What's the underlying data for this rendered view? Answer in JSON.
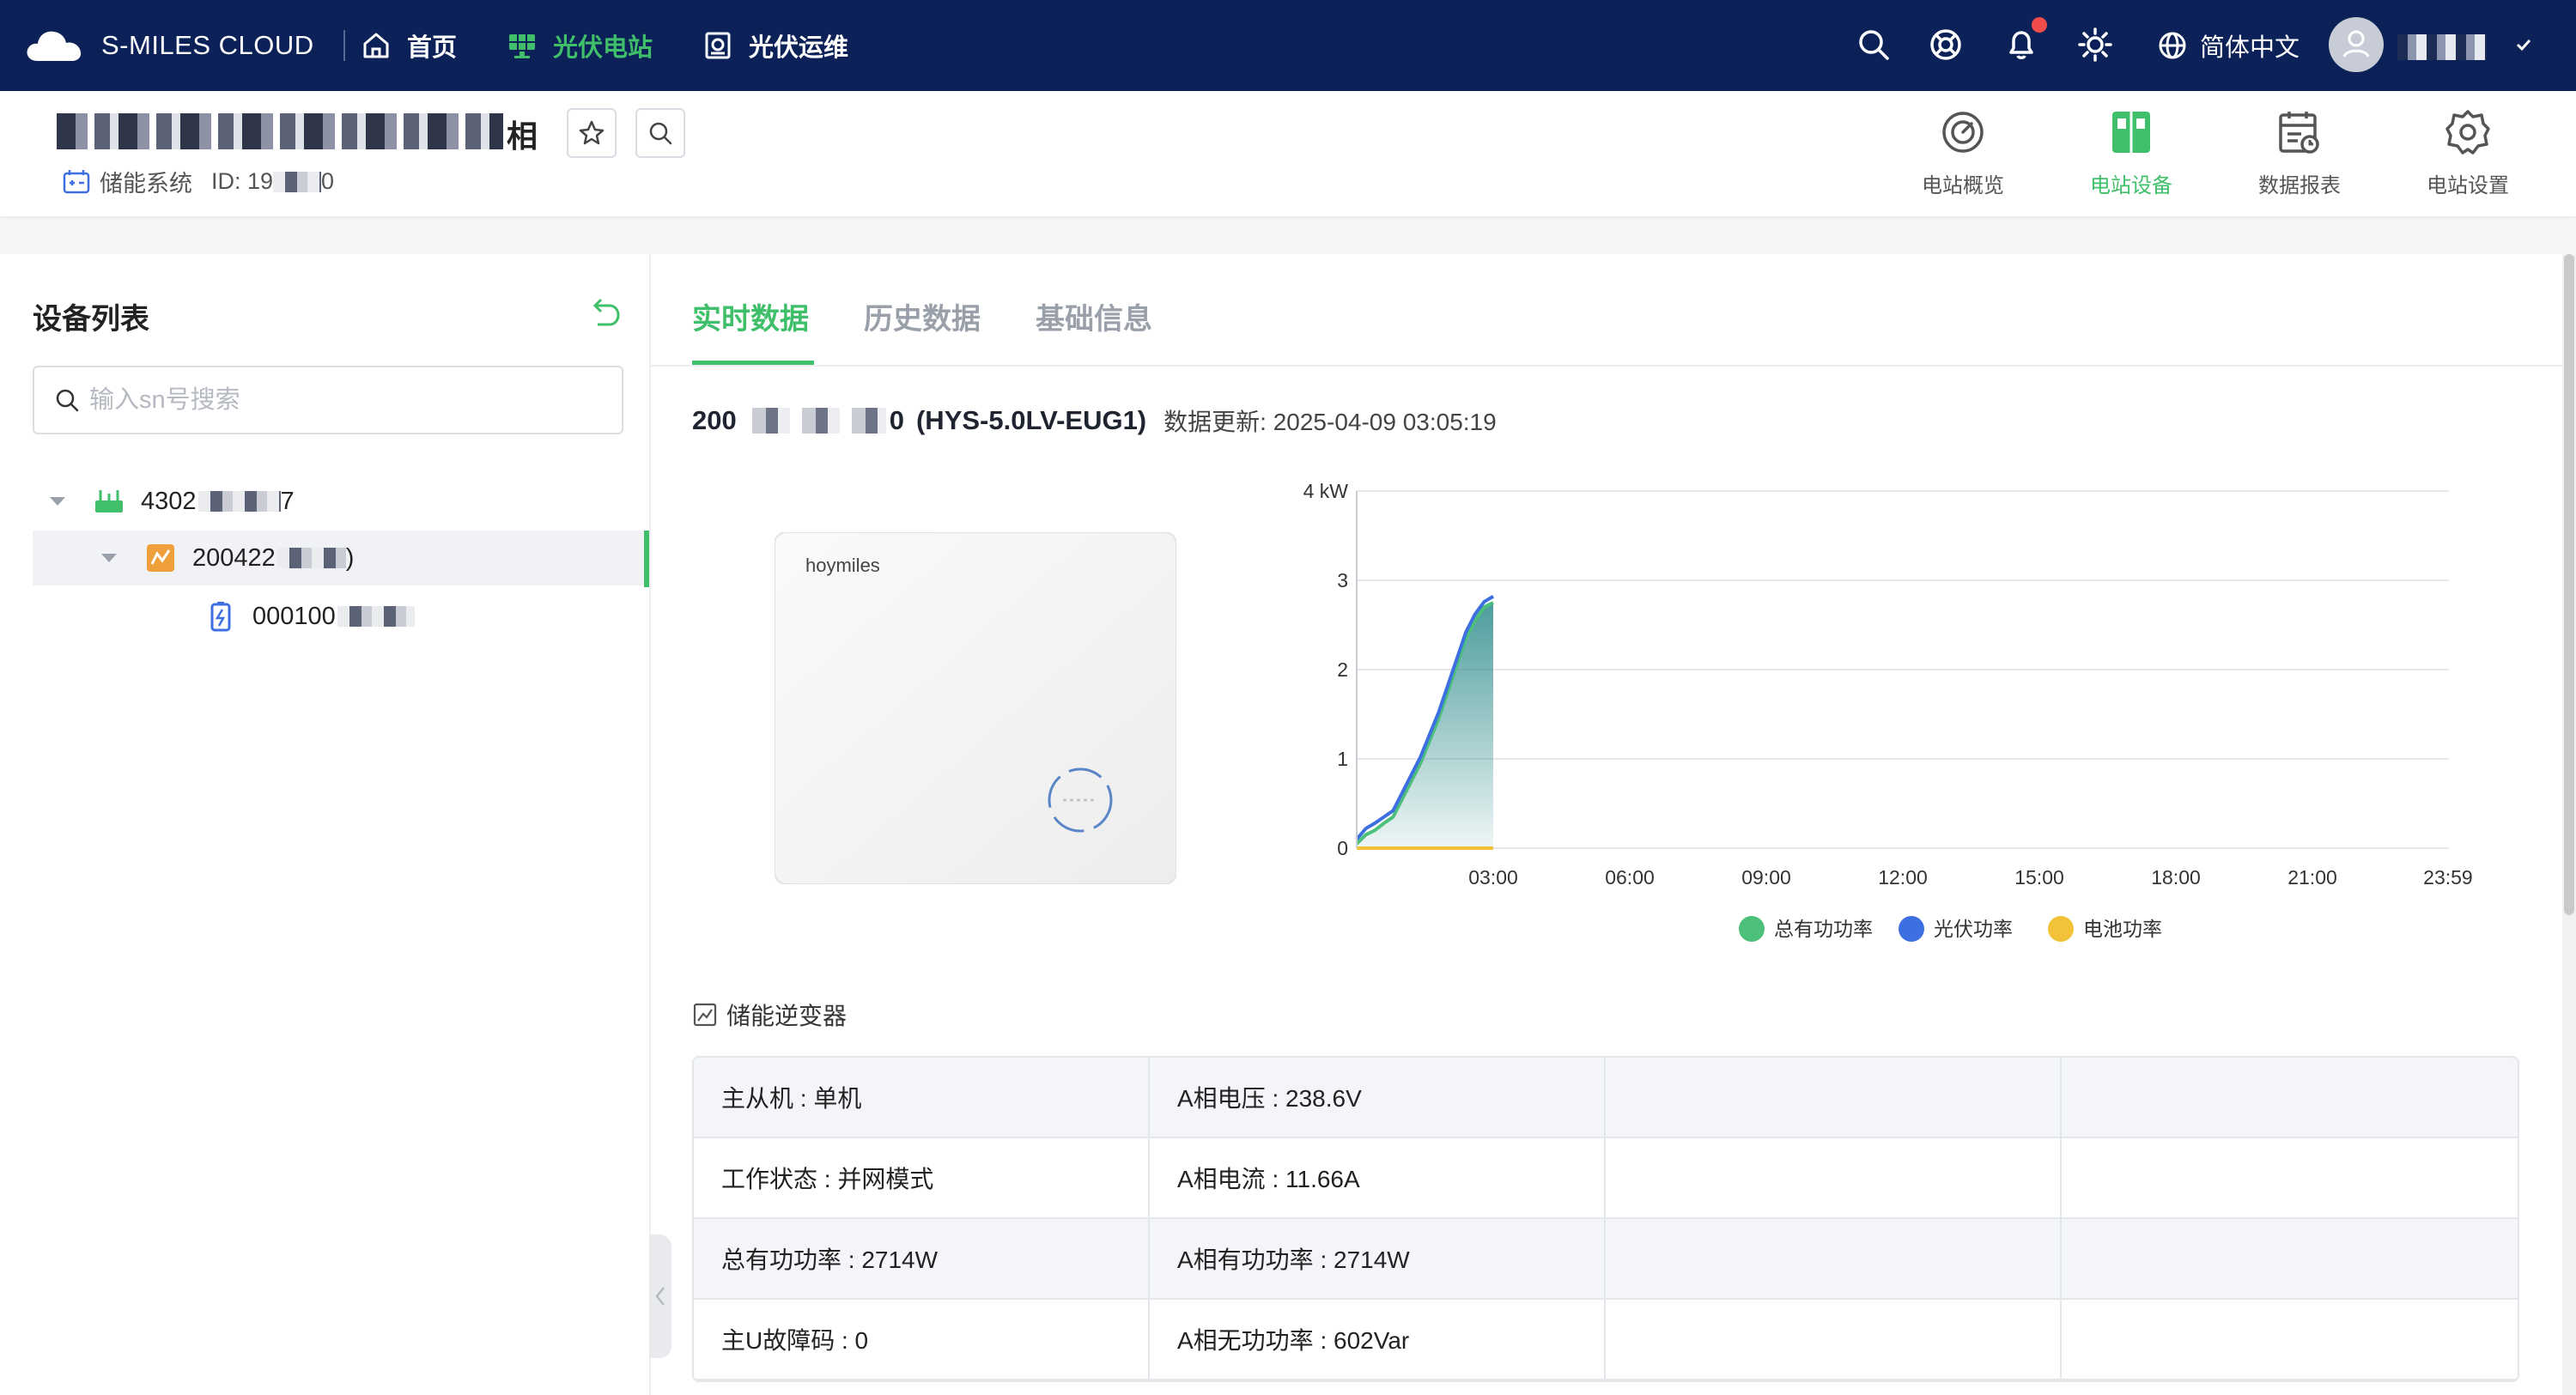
{
  "topbar": {
    "brand": "S-MILES CLOUD",
    "nav": [
      {
        "label": "首页",
        "icon": "home-icon"
      },
      {
        "label": "光伏电站",
        "icon": "solar-panel-icon",
        "active": true
      },
      {
        "label": "光伏运维",
        "icon": "maintenance-icon"
      }
    ],
    "language": "简体中文",
    "accent": "#3fbf6a",
    "background": "#0b2157"
  },
  "station": {
    "name_suffix": "相",
    "system_type": "储能系统",
    "id_label": "ID: 19",
    "id_tail": "0",
    "tools": [
      {
        "label": "电站概览",
        "icon": "gauge-icon"
      },
      {
        "label": "电站设备",
        "icon": "device-icon",
        "active": true
      },
      {
        "label": "数据报表",
        "icon": "report-icon"
      },
      {
        "label": "电站设置",
        "icon": "gear-icon"
      }
    ]
  },
  "device_list": {
    "title": "设备列表",
    "search_placeholder": "输入sn号搜索",
    "items": [
      {
        "sn_prefix": "4302",
        "sn_suffix": "7",
        "icon": "router-icon"
      },
      {
        "sn_prefix": "200422",
        "sn_suffix": ")",
        "icon": "inverter-icon",
        "selected": true
      },
      {
        "sn_prefix": "000100",
        "sn_suffix": "",
        "icon": "battery-icon"
      }
    ]
  },
  "tabs": [
    {
      "label": "实时数据",
      "active": true
    },
    {
      "label": "历史数据"
    },
    {
      "label": "基础信息"
    }
  ],
  "device": {
    "sn_prefix": "200",
    "sn_suffix": "0",
    "model": "(HYS-5.0LV-EUG1)",
    "update_label": "数据更新: 2025-04-09 03:05:19",
    "logo_text": "hoymiles"
  },
  "chart_data": {
    "type": "area",
    "x_ticks": [
      "03:00",
      "06:00",
      "09:00",
      "12:00",
      "15:00",
      "18:00",
      "21:00",
      "23:59"
    ],
    "y_ticks": [
      "0",
      "1",
      "2",
      "3",
      "4 kW"
    ],
    "ylim": [
      0,
      4
    ],
    "xlim_hours": [
      0,
      24
    ],
    "legend_position": "bottom",
    "series": [
      {
        "name": "总有功功率",
        "color": "#4cc07a",
        "x": [
          0,
          0.2,
          0.4,
          0.6,
          0.8,
          1.0,
          1.2,
          1.4,
          1.6,
          1.8,
          2.0,
          2.2,
          2.4,
          2.6,
          2.8,
          3.0
        ],
        "values": [
          0.05,
          0.15,
          0.2,
          0.28,
          0.35,
          0.55,
          0.75,
          0.95,
          1.2,
          1.45,
          1.75,
          2.05,
          2.35,
          2.55,
          2.7,
          2.75
        ]
      },
      {
        "name": "光伏功率",
        "color": "#3d6fe0",
        "x": [
          0,
          0.2,
          0.4,
          0.6,
          0.8,
          1.0,
          1.2,
          1.4,
          1.6,
          1.8,
          2.0,
          2.2,
          2.4,
          2.6,
          2.8,
          3.0
        ],
        "values": [
          0.1,
          0.22,
          0.28,
          0.35,
          0.42,
          0.62,
          0.82,
          1.02,
          1.27,
          1.52,
          1.82,
          2.12,
          2.42,
          2.62,
          2.76,
          2.82
        ]
      },
      {
        "name": "电池功率",
        "color": "#f2c338",
        "x": [
          0,
          3.0
        ],
        "values": [
          0,
          0
        ]
      }
    ]
  },
  "section": {
    "title": "储能逆变器"
  },
  "table": [
    [
      "主从机 : 单机",
      "A相电压 : 238.6V",
      "",
      ""
    ],
    [
      "工作状态 : 并网模式",
      "A相电流 : 11.66A",
      "",
      ""
    ],
    [
      "总有功功率 : 2714W",
      "A相有功功率 : 2714W",
      "",
      ""
    ],
    [
      "主U故障码 : 0",
      "A相无功功率 : 602Var",
      "",
      ""
    ]
  ]
}
